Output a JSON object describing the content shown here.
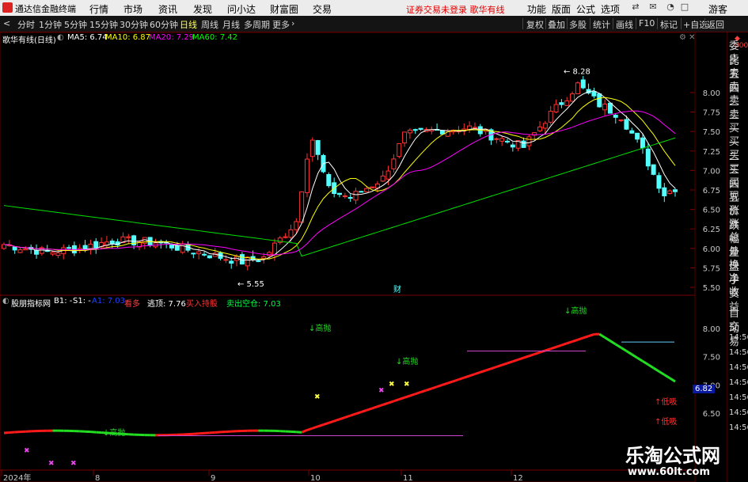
{
  "app": {
    "name": "通达信金融终端"
  },
  "menu": {
    "items": [
      "行情",
      "市场",
      "资讯",
      "发现",
      "问小达",
      "财富圈",
      "交易"
    ],
    "notice": "证券交易未登录  歌华有线",
    "right_items": [
      "功能",
      "版面",
      "公式",
      "选项"
    ],
    "user": "游客"
  },
  "toolbar": {
    "periods": [
      "分时",
      "1分钟",
      "5分钟",
      "15分钟",
      "30分钟",
      "60分钟",
      "日线",
      "周线",
      "月线",
      "多周期",
      "更多"
    ],
    "active_period": "日线",
    "tools": [
      "复权",
      "叠加",
      "多股",
      "统计",
      "画线",
      "F10",
      "标记",
      "+自选",
      "返回"
    ]
  },
  "main_chart": {
    "title": "歌华有线(日线)",
    "legend": [
      {
        "label": "MA5: 6.74",
        "color": "#ffffff"
      },
      {
        "label": "MA10: 6.87",
        "color": "#ffff00"
      },
      {
        "label": "MA20: 7.29",
        "color": "#ff00ff"
      },
      {
        "label": "MA60: 7.42",
        "color": "#00ff00"
      }
    ],
    "price_axis": [
      "8.00",
      "7.75",
      "7.50",
      "7.25",
      "7.00",
      "6.75",
      "6.50",
      "6.25",
      "6.00",
      "5.75",
      "5.50"
    ],
    "high_label": "8.28",
    "low_label": "5.55",
    "event_marker": "财"
  },
  "indicator": {
    "name": "股朋指标网",
    "legend": [
      {
        "label": "B1: -",
        "color": "#ffffff"
      },
      {
        "label": "S1: -",
        "color": "#ffffff"
      },
      {
        "label": "A1: 7.03",
        "color": "#2040ff"
      },
      {
        "label": "看多",
        "color": "#ff4040"
      },
      {
        "label": "逃顶: 7.76",
        "color": "#ffffff"
      },
      {
        "label": "买入持股",
        "color": "#ff3030"
      },
      {
        "label": "卖出空仓: 7.03",
        "color": "#00ff40"
      }
    ],
    "price_axis": [
      "8.00",
      "7.50",
      "7.00",
      "6.50"
    ],
    "signals": [
      "高抛",
      "高抛",
      "高抛",
      "高抛",
      "低吸",
      "低吸"
    ],
    "current_value": "6.82"
  },
  "time_axis": [
    "2024年",
    "8",
    "9",
    "10",
    "11",
    "12"
  ],
  "side_panel": {
    "labels": [
      "委比",
      "卖五",
      "卖四",
      "卖三",
      "卖二",
      "卖一",
      "买一",
      "买二",
      "买三",
      "买四",
      "买五",
      "现价",
      "涨跌",
      "涨幅",
      "总量",
      "外盘",
      "换手",
      "净资",
      "收益",
      "自动",
      "交易"
    ],
    "times": [
      "14:56",
      "14:56",
      "14:56",
      "14:56",
      "14:56",
      "14:56",
      "14:56"
    ]
  },
  "watermark": {
    "title": "乐淘公式网",
    "url": "www.60lt.com"
  }
}
